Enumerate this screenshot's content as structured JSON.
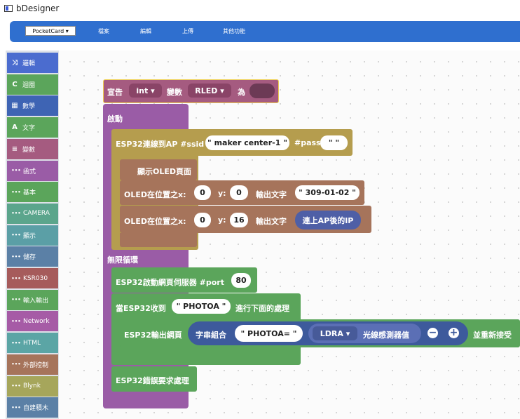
{
  "app": {
    "title": "bDesigner"
  },
  "menubar": {
    "device": "PocketCard ▾",
    "items": [
      "檔案",
      "編輯",
      "上傳",
      "其他功能"
    ]
  },
  "toolbox": {
    "categories": [
      {
        "label": "邏輯",
        "icon": "⤨",
        "color": "#4b6ccf"
      },
      {
        "label": "迴圈",
        "icon": "C",
        "color": "#5ba55b"
      },
      {
        "label": "數學",
        "icon": "▦",
        "color": "#3e64b4"
      },
      {
        "label": "文字",
        "icon": "A",
        "color": "#5ba55b"
      },
      {
        "label": "變數",
        "icon": "≡",
        "color": "#a55b80"
      },
      {
        "label": "函式",
        "icon": "•••",
        "color": "#9a5ca6"
      },
      {
        "label": "基本",
        "icon": "•••",
        "color": "#5ba55b"
      },
      {
        "label": "CAMERA",
        "icon": "•••",
        "color": "#5ba58c"
      },
      {
        "label": "顯示",
        "icon": "•••",
        "color": "#5b9fa6"
      },
      {
        "label": "儲存",
        "icon": "•••",
        "color": "#5b80a6"
      },
      {
        "label": "KSR030",
        "icon": "•••",
        "color": "#a65b5b"
      },
      {
        "label": "輸入輸出",
        "icon": "•••",
        "color": "#5ba55b"
      },
      {
        "label": "Network",
        "icon": "•••",
        "color": "#a65ba6"
      },
      {
        "label": "HTML",
        "icon": "•••",
        "color": "#5ba5a5"
      },
      {
        "label": "外部控制",
        "icon": "•••",
        "color": "#a6745b"
      },
      {
        "label": "Blynk",
        "icon": "•••",
        "color": "#a6a65b"
      },
      {
        "label": "自建積木",
        "icon": "•••",
        "color": "#5b80a6"
      }
    ]
  },
  "blocks": {
    "declare": {
      "label": "宣告",
      "type": "int ▾",
      "var_label": "變數",
      "var": "RLED ▾",
      "as": "為"
    },
    "setup": {
      "label": "啟動"
    },
    "wifi": {
      "label": "ESP32連線到AP #ssid",
      "ssid": "\" maker center-1 \"",
      "pass_label": "#pass",
      "pass": "\"   \""
    },
    "oled_show": {
      "label": "顯示OLED頁面"
    },
    "oled1": {
      "label": "OLED在位置之x:",
      "x": "0",
      "y_label": "y:",
      "y": "0",
      "out_label": "輸出文字",
      "text": "\" 309-01-02 \""
    },
    "oled2": {
      "label": "OLED在位置之x:",
      "x": "0",
      "y_label": "y:",
      "y": "16",
      "out_label": "輸出文字",
      "text": "連上AP後的IP"
    },
    "loop": {
      "label": "無限循環"
    },
    "webserver": {
      "label": "ESP32啟動網頁伺服器 #port",
      "port": "80"
    },
    "onrecv": {
      "label": "當ESP32收到",
      "text": "\" PHOTOA \"",
      "then": "進行下面的處理"
    },
    "output": {
      "label": "ESP32輸出網頁",
      "join": "字串組合",
      "text": "\" PHOTOA= \"",
      "sensor_pin": "LDRA ▾",
      "sensor_label": "光線感測器值",
      "tail": "並重新接受"
    },
    "error": {
      "label": "ESP32錯誤要求處理"
    }
  },
  "colors": {
    "variable": "#a55b80",
    "setup": "#9a5ca6",
    "wifi": "#b59d4e",
    "oled": "#a6745b",
    "network": "#5ba55b",
    "join": "#3d5a9c",
    "sensor": "#5b6fb5"
  }
}
